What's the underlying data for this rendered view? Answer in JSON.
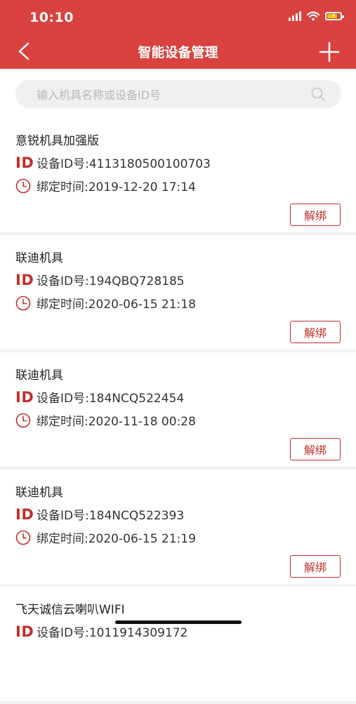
{
  "status": {
    "time": "10:10"
  },
  "header": {
    "title": "智能设备管理"
  },
  "search": {
    "placeholder": "输入机具名称或设备ID号"
  },
  "labels": {
    "id_mark": "ID",
    "unbind": "解绑"
  },
  "colors": {
    "brand": "#d9423f",
    "accent": "#c0302c"
  },
  "devices": [
    {
      "name": "意锐机具加强版",
      "device_id": "设备ID号:4113180500100703",
      "bind_time": "绑定时间:2019-12-20 17:14"
    },
    {
      "name": "联迪机具",
      "device_id": "设备ID号:194QBQ728185",
      "bind_time": "绑定时间:2020-06-15 21:18"
    },
    {
      "name": "联迪机具",
      "device_id": "设备ID号:184NCQ522454",
      "bind_time": "绑定时间:2020-11-18 00:28"
    },
    {
      "name": "联迪机具",
      "device_id": "设备ID号:184NCQ522393",
      "bind_time": "绑定时间:2020-06-15 21:19"
    },
    {
      "name": "飞天诚信云喇叭WIFI",
      "device_id": "设备ID号:1011914309172",
      "bind_time": ""
    }
  ]
}
